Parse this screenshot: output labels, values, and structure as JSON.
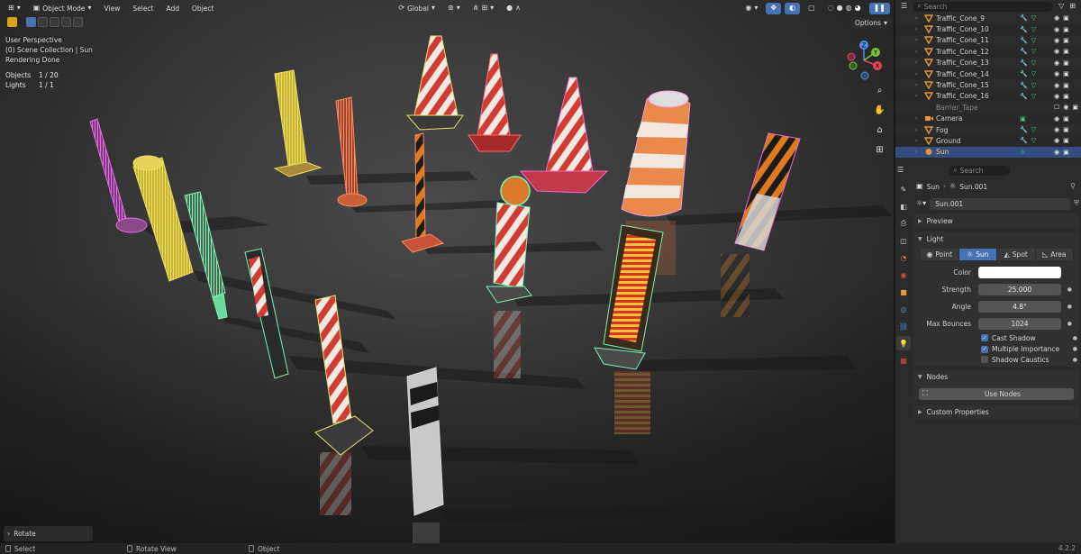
{
  "viewport": {
    "header": {
      "mode": "Object Mode",
      "menus": [
        "View",
        "Select",
        "Add",
        "Object"
      ],
      "orientation": "Global",
      "options": "Options"
    },
    "info": {
      "perspective": "User Perspective",
      "collection": "(0) Scene Collection | Sun",
      "status": "Rendering Done"
    },
    "stats": {
      "objects_label": "Objects",
      "objects_value": "1 / 20",
      "lights_label": "Lights",
      "lights_value": "1 / 1"
    },
    "gizmo": {
      "x": "X",
      "y": "Y",
      "z": "Z"
    },
    "last_operator": "Rotate"
  },
  "outliner": {
    "search_placeholder": "Search",
    "rows": [
      {
        "name": "Traffic_Cone_9",
        "type": "mesh"
      },
      {
        "name": "Traffic_Cone_10",
        "type": "mesh"
      },
      {
        "name": "Traffic_Cone_11",
        "type": "mesh"
      },
      {
        "name": "Traffic_Cone_12",
        "type": "mesh"
      },
      {
        "name": "Traffic_Cone_13",
        "type": "mesh"
      },
      {
        "name": "Traffic_Cone_14",
        "type": "mesh"
      },
      {
        "name": "Traffic_Cone_15",
        "type": "mesh"
      },
      {
        "name": "Traffic_Cone_16",
        "type": "mesh"
      },
      {
        "name": "Barrier_Tape",
        "type": "mesh"
      },
      {
        "name": "Camera",
        "type": "camera"
      },
      {
        "name": "Fog",
        "type": "mesh"
      },
      {
        "name": "Ground",
        "type": "mesh"
      },
      {
        "name": "Sun",
        "type": "light"
      }
    ]
  },
  "properties": {
    "search_placeholder": "Search",
    "breadcrumb_object": "Sun",
    "breadcrumb_data": "Sun.001",
    "datablock": "Sun.001",
    "panels": {
      "preview": "Preview",
      "light": "Light",
      "nodes": "Nodes",
      "custom": "Custom Properties"
    },
    "light_types": [
      "Point",
      "Sun",
      "Spot",
      "Area"
    ],
    "selected_light_type": "Sun",
    "fields": {
      "color_label": "Color",
      "color_value": "#ffffff",
      "strength_label": "Strength",
      "strength_value": "25.000",
      "angle_label": "Angle",
      "angle_value": "4.8°",
      "bounces_label": "Max Bounces",
      "bounces_value": "1024"
    },
    "checkboxes": {
      "cast_shadow": "Cast Shadow",
      "multiple_importance": "Multiple Importance",
      "shadow_caustics": "Shadow Caustics"
    },
    "use_nodes": "Use Nodes"
  },
  "statusbar": {
    "select": "Select",
    "rotate_view": "Rotate View",
    "object": "Object",
    "version": "4.2.2"
  },
  "colors": {
    "accent": "#4772b3",
    "selected_row": "#334d80",
    "active_object": "#ffcc66",
    "mesh_icon": "#e8953a",
    "modifier_icon": "#7fb2e6",
    "material_icon": "#3fcf7a"
  }
}
